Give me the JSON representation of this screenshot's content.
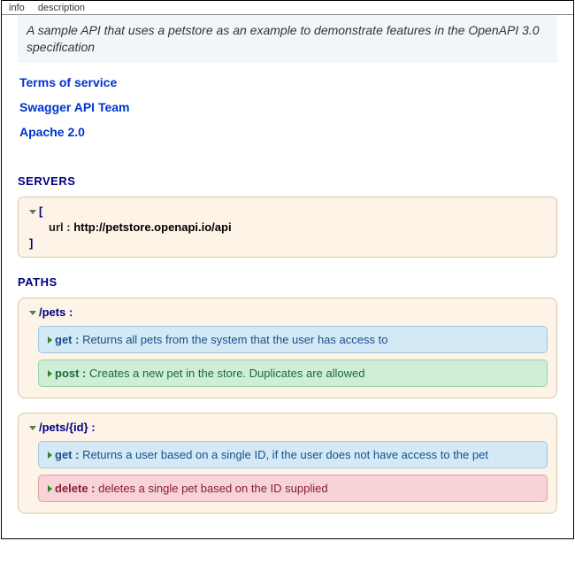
{
  "tabs": {
    "info": "info",
    "description": "description"
  },
  "description": "A sample API that uses a petstore as an example to demonstrate features in the OpenAPI 3.0 specification",
  "links": {
    "terms": "Terms of service",
    "contact": "Swagger API Team",
    "license": "Apache 2.0"
  },
  "sections": {
    "servers": "SERVERS",
    "paths": "PATHS"
  },
  "servers": {
    "url_key": "url :",
    "url_val": "http://petstore.openapi.io/api"
  },
  "paths": [
    {
      "name": "/pets :",
      "ops": [
        {
          "method": "get :",
          "summary": "Returns all pets from the system that the user has access to",
          "type": "get"
        },
        {
          "method": "post :",
          "summary": "Creates a new pet in the store. Duplicates are allowed",
          "type": "post"
        }
      ]
    },
    {
      "name": "/pets/{id} :",
      "ops": [
        {
          "method": "get :",
          "summary": "Returns a user based on a single ID, if the user does not have access to the pet",
          "type": "get"
        },
        {
          "method": "delete :",
          "summary": "deletes a single pet based on the ID supplied",
          "type": "delete"
        }
      ]
    }
  ]
}
